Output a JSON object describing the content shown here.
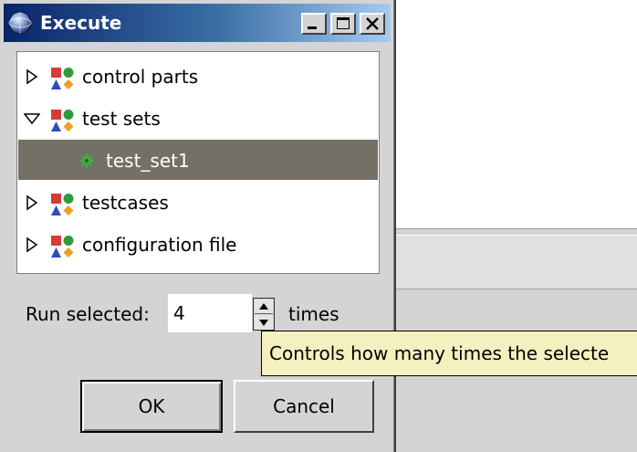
{
  "window": {
    "title": "Execute",
    "title_icon": "globe-icon",
    "controls": [
      "minimize-icon",
      "maximize-icon",
      "close-icon"
    ]
  },
  "tree": {
    "items": [
      {
        "label": "control parts",
        "expanded": false,
        "icon": "category-shapes-icon"
      },
      {
        "label": "test sets",
        "expanded": true,
        "icon": "category-shapes-icon",
        "children": [
          {
            "label": "test_set1",
            "selected": true,
            "icon": "gear-icon"
          }
        ]
      },
      {
        "label": "testcases",
        "expanded": false,
        "icon": "category-shapes-icon"
      },
      {
        "label": "configuration file",
        "expanded": false,
        "icon": "category-shapes-icon"
      }
    ]
  },
  "run": {
    "label": "Run selected:",
    "value": "4",
    "suffix": "times"
  },
  "tooltip": {
    "text": "Controls how many times the selecte"
  },
  "buttons": {
    "ok": "OK",
    "cancel": "Cancel"
  },
  "colors": {
    "selection": "#747066",
    "tooltip_bg": "#f5f0c0",
    "titlebar_start": "#0a246a"
  }
}
